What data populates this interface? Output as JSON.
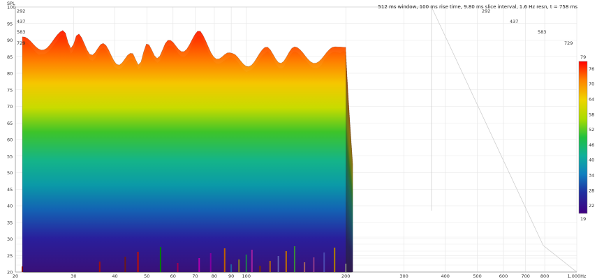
{
  "chart_data": {
    "type": "waterfall-3d",
    "title": "512 ms window, 100 ms rise time, 9.80 ms slice interval, 1.6 Hz resn, t = 758 ms",
    "ylabel": "SPL",
    "y_ticks": [
      "20",
      "25",
      "30",
      "35",
      "40",
      "45",
      "50",
      "55",
      "60",
      "65",
      "70",
      "75",
      "80",
      "85",
      "90",
      "95",
      "100"
    ],
    "x_ticks": [
      "20",
      "30",
      "40",
      "50",
      "60",
      "70",
      "80",
      "90",
      "100",
      "200",
      "300",
      "400",
      "500",
      "600",
      "700",
      "800",
      "1,000Hz"
    ],
    "time_ticks": [
      "292",
      "437",
      "583",
      "729"
    ],
    "colorbar_ticks": [
      "79",
      "76",
      "70",
      "64",
      "58",
      "52",
      "46",
      "40",
      "34",
      "28",
      "22",
      "19"
    ],
    "xlim": [
      20,
      1000
    ],
    "ylim": [
      20,
      100
    ],
    "clim": [
      19,
      79
    ],
    "scale": "log-frequency",
    "colormap": "rainbow",
    "front_slice_peaks": [
      {
        "freq": 21,
        "spl": 91
      },
      {
        "freq": 28,
        "spl": 93
      },
      {
        "freq": 31,
        "spl": 92
      },
      {
        "freq": 37,
        "spl": 89
      },
      {
        "freq": 45,
        "spl": 86
      },
      {
        "freq": 50,
        "spl": 89
      },
      {
        "freq": 58,
        "spl": 90
      },
      {
        "freq": 72,
        "spl": 93
      },
      {
        "freq": 90,
        "spl": 86
      },
      {
        "freq": 115,
        "spl": 88
      },
      {
        "freq": 140,
        "spl": 88
      },
      {
        "freq": 185,
        "spl": 88
      }
    ],
    "colors": {
      "grid": "#d6d6d6",
      "floor": "#f4f4f4"
    }
  }
}
